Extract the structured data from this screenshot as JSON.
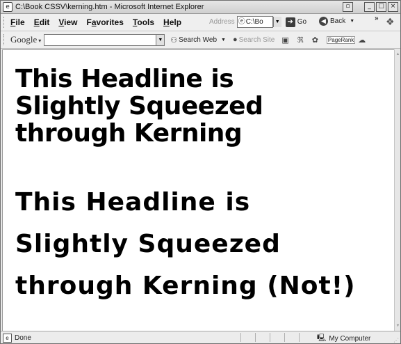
{
  "window": {
    "title": "C:\\Book CSSV\\kerning.htm - Microsoft Internet Explorer",
    "controls": [
      "_",
      "□",
      "×"
    ]
  },
  "menu": {
    "items": [
      {
        "underline": "F",
        "rest": "ile"
      },
      {
        "underline": "E",
        "rest": "dit"
      },
      {
        "underline": "V",
        "rest": "iew"
      },
      {
        "underline": "a",
        "rest": "Favorites",
        "pre": "F",
        "post": "vorites"
      },
      {
        "underline": "T",
        "rest": "ools"
      },
      {
        "underline": "H",
        "rest": "elp"
      }
    ],
    "address_label": "Address",
    "address_value": "C:\\Bo",
    "go_label": "Go",
    "back_label": "Back",
    "chevron": "»"
  },
  "google_toolbar": {
    "label": "Google",
    "search_web": "Search Web",
    "search_site": "Search Site",
    "pagerank": "PageRank"
  },
  "content": {
    "headline_kerned": [
      "This Headline is",
      "Slightly Squeezed",
      "through Kerning"
    ],
    "headline_normal": [
      "This Headline is",
      "Slightly Squeezed",
      "through Kerning (Not!)"
    ]
  },
  "status": {
    "text": "Done",
    "zone": "My Computer"
  },
  "icons": {
    "title": "ie-page-icon",
    "go": "go-arrow-icon",
    "back": "back-arrow-icon",
    "status": "page-done-icon",
    "zone": "my-computer-icon"
  }
}
